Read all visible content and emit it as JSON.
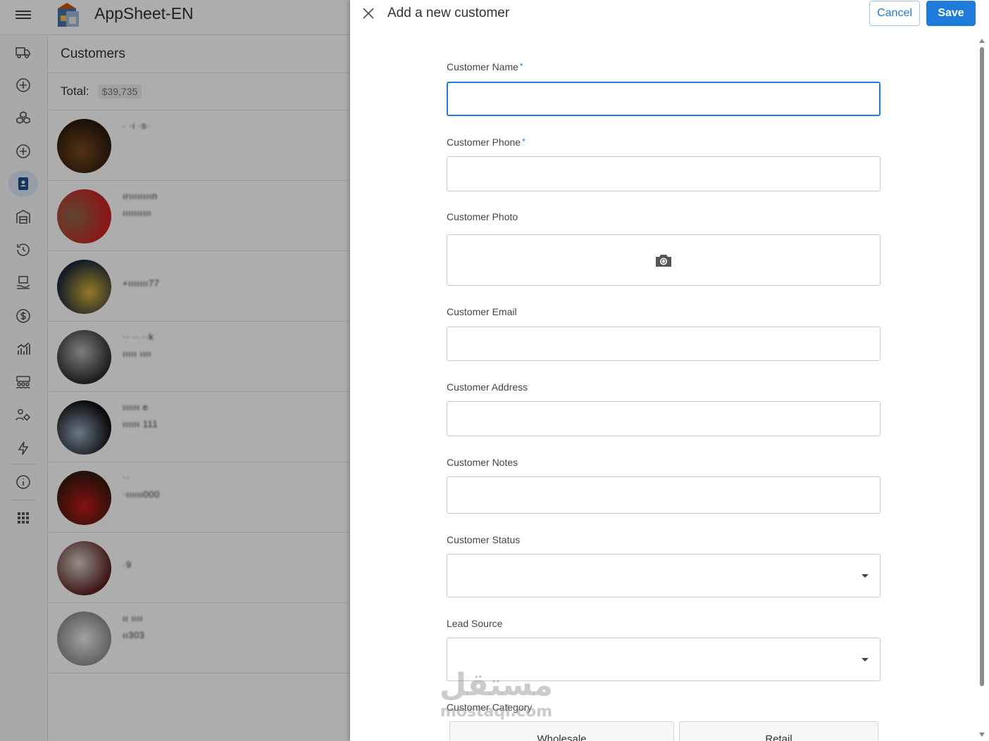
{
  "app": {
    "title": "AppSheet-EN",
    "menu_icon": "hamburger-menu-icon",
    "nav_items": [
      {
        "icon": "truck-icon",
        "label": "Deliveries"
      },
      {
        "icon": "plus-circle-icon",
        "label": "Add"
      },
      {
        "icon": "boxes-icon",
        "label": "Products"
      },
      {
        "icon": "plus-circle-icon",
        "label": "Add"
      },
      {
        "icon": "contact-book-icon",
        "label": "Customers",
        "active": true
      },
      {
        "icon": "warehouse-icon",
        "label": "Warehouse"
      },
      {
        "icon": "history-icon",
        "label": "History"
      },
      {
        "icon": "payment-hand-icon",
        "label": "Payments"
      },
      {
        "icon": "dollar-circle-icon",
        "label": "Finance"
      },
      {
        "icon": "bar-chart-icon",
        "label": "Reports"
      },
      {
        "icon": "team-icon",
        "label": "Team"
      },
      {
        "icon": "user-settings-icon",
        "label": "Users"
      },
      {
        "icon": "lightning-icon",
        "label": "Automation"
      },
      {
        "icon": "info-icon",
        "label": "About"
      },
      {
        "icon": "apps-grid-icon",
        "label": "More"
      }
    ]
  },
  "customers_view": {
    "title": "Customers",
    "total_label": "Total:",
    "total_value": "$39,735",
    "rows": [
      {
        "line1": "· ·ı  ·s·",
        "line2": ""
      },
      {
        "line1": "ırıııııııın",
        "line2": "ıııııııııı"
      },
      {
        "line1": "",
        "line2": "+ııııııı77"
      },
      {
        "line1": "·· ·· ··k",
        "line2": "ııııı ıııı"
      },
      {
        "line1": "ıııııı e",
        "line2": "ıııııı 111"
      },
      {
        "line1": "··",
        "line2": "·ıııııı000"
      },
      {
        "line1": "",
        "line2": "·9"
      },
      {
        "line1": "ıı ıııı",
        "line2": "ıı303"
      }
    ]
  },
  "dialog": {
    "title": "Add a new customer",
    "cancel_label": "Cancel",
    "save_label": "Save",
    "fields": {
      "name": {
        "label": "Customer Name",
        "required": "*",
        "value": ""
      },
      "phone": {
        "label": "Customer Phone",
        "required": "*",
        "value": ""
      },
      "photo": {
        "label": "Customer Photo",
        "icon": "camera-icon"
      },
      "email": {
        "label": "Customer Email",
        "value": ""
      },
      "address": {
        "label": "Customer Address",
        "value": ""
      },
      "notes": {
        "label": "Customer Notes",
        "value": ""
      },
      "status": {
        "label": "Customer Status",
        "value": ""
      },
      "lead_source": {
        "label": "Lead Source",
        "value": ""
      },
      "category": {
        "label": "Customer Category",
        "options": [
          "Wholesale",
          "Retail"
        ]
      }
    }
  },
  "watermark": {
    "arabic": "مستقل",
    "latin": "mostaql.com"
  },
  "colors": {
    "accent": "#1e7bd9",
    "overlay": "rgba(0,0,0,0.32)"
  }
}
